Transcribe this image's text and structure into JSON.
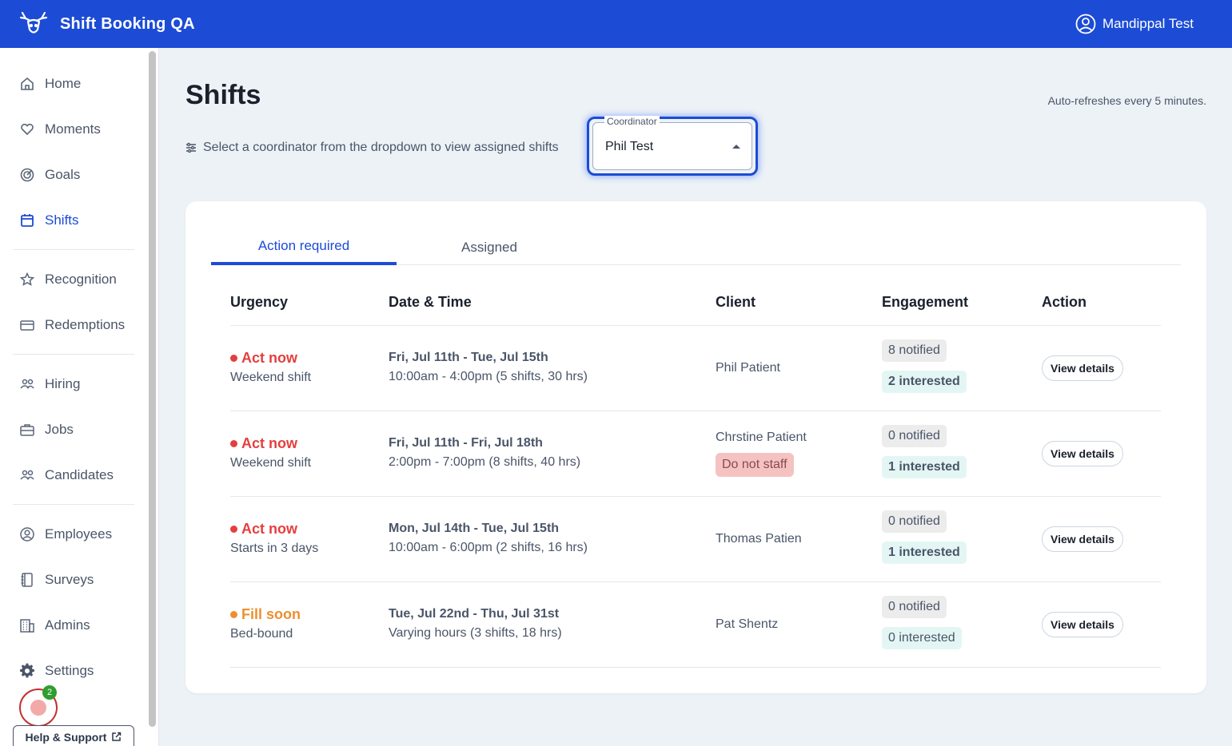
{
  "header": {
    "brand_title": "Shift Booking QA",
    "user_name": "Mandippal Test"
  },
  "sidebar": {
    "groups": [
      [
        {
          "label": "Home",
          "icon": "home-icon"
        },
        {
          "label": "Moments",
          "icon": "heart-icon"
        },
        {
          "label": "Goals",
          "icon": "target-icon"
        },
        {
          "label": "Shifts",
          "icon": "calendar-icon",
          "active": true
        }
      ],
      [
        {
          "label": "Recognition",
          "icon": "star-icon"
        },
        {
          "label": "Redemptions",
          "icon": "card-icon"
        }
      ],
      [
        {
          "label": "Hiring",
          "icon": "people-icon"
        },
        {
          "label": "Jobs",
          "icon": "briefcase-icon"
        },
        {
          "label": "Candidates",
          "icon": "people-icon"
        }
      ],
      [
        {
          "label": "Employees",
          "icon": "user-circle-icon"
        },
        {
          "label": "Surveys",
          "icon": "notebook-icon"
        },
        {
          "label": "Admins",
          "icon": "building-icon"
        },
        {
          "label": "Settings",
          "icon": "gear-icon"
        }
      ]
    ],
    "notification_count": "2",
    "help_label": "Help & Support"
  },
  "main": {
    "title": "Shifts",
    "auto_refresh": "Auto-refreshes every 5 minutes.",
    "hint": "Select a coordinator from the dropdown to view assigned shifts",
    "coordinator": {
      "label": "Coordinator",
      "value": "Phil Test"
    },
    "tabs": [
      {
        "label": "Action required",
        "active": true
      },
      {
        "label": "Assigned",
        "active": false
      }
    ],
    "table": {
      "columns": [
        "Urgency",
        "Date & Time",
        "Client",
        "Engagement",
        "Action"
      ],
      "rows": [
        {
          "urgency": "Act now",
          "urgency_color": "#e53e3e",
          "urgency_sub": "Weekend shift",
          "date_range": "Fri, Jul 11th - Tue, Jul 15th",
          "hours": "10:00am - 4:00pm (5 shifts, 30 hrs)",
          "client": "Phil Patient",
          "client_flag": "",
          "notified": "8 notified",
          "interested": "2 interested",
          "interested_strong": true,
          "action": "View details"
        },
        {
          "urgency": "Act now",
          "urgency_color": "#e53e3e",
          "urgency_sub": "Weekend shift",
          "date_range": "Fri, Jul 11th - Fri, Jul 18th",
          "hours": "2:00pm - 7:00pm (8 shifts, 40 hrs)",
          "client": "Chrstine Patient",
          "client_flag": "Do not staff",
          "notified": "0 notified",
          "interested": "1 interested",
          "interested_strong": true,
          "action": "View details"
        },
        {
          "urgency": "Act now",
          "urgency_color": "#e53e3e",
          "urgency_sub": "Starts in 3 days",
          "date_range": "Mon, Jul 14th - Tue, Jul 15th",
          "hours": "10:00am - 6:00pm (2 shifts, 16 hrs)",
          "client": "Thomas Patien",
          "client_flag": "",
          "notified": "0 notified",
          "interested": "1 interested",
          "interested_strong": true,
          "action": "View details"
        },
        {
          "urgency": "Fill soon",
          "urgency_color": "#ed8f2f",
          "urgency_sub": "Bed-bound",
          "date_range": "Tue, Jul 22nd - Thu, Jul 31st",
          "hours": "Varying hours (3 shifts, 18 hrs)",
          "client": "Pat Shentz",
          "client_flag": "",
          "notified": "0 notified",
          "interested": "0 interested",
          "interested_strong": false,
          "action": "View details"
        }
      ]
    }
  }
}
